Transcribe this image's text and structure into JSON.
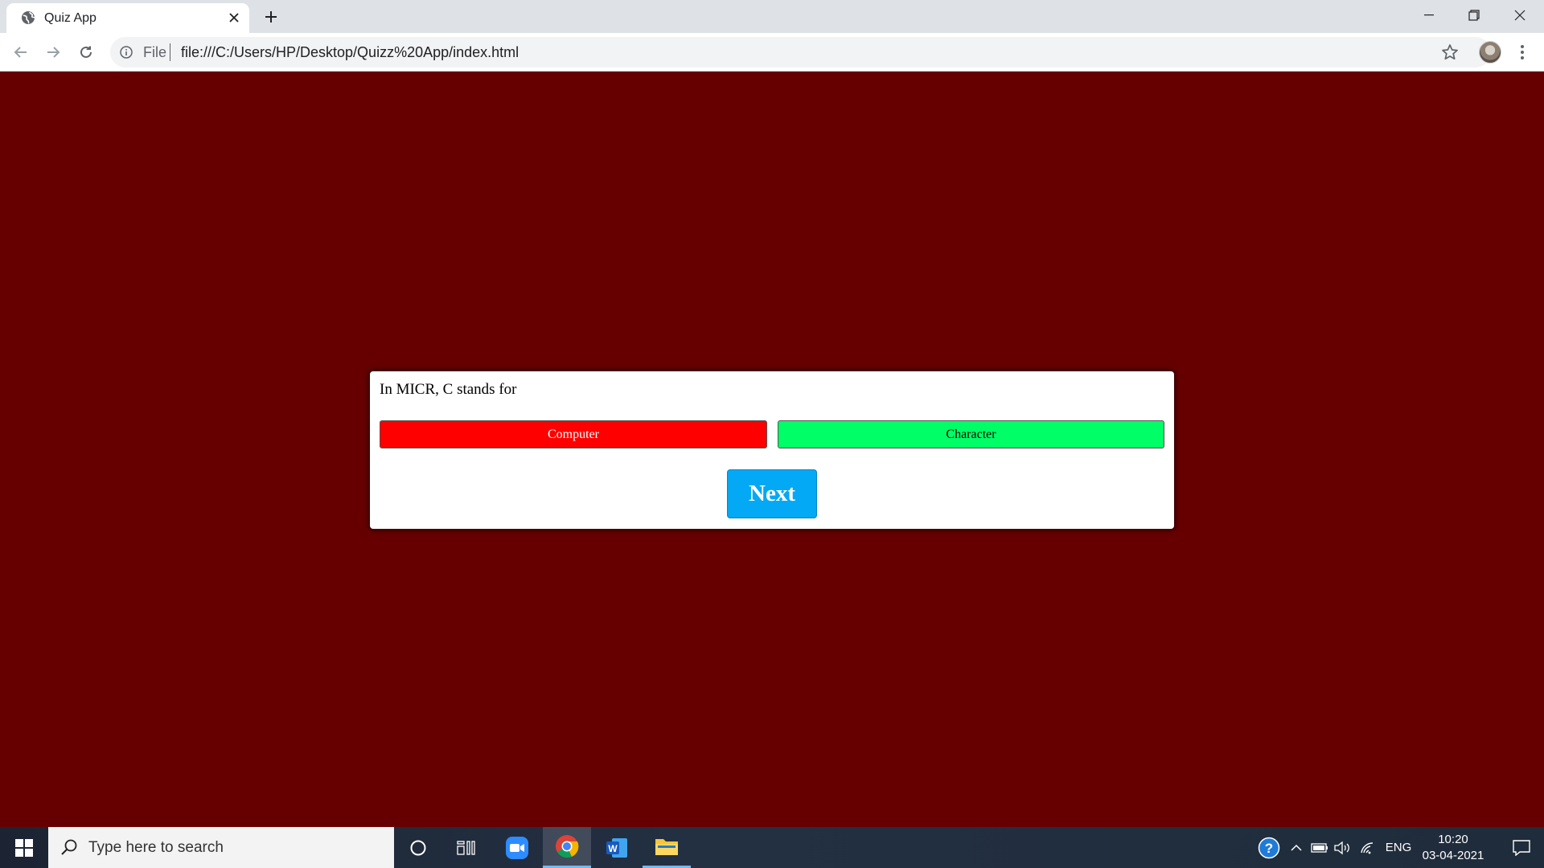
{
  "browser": {
    "tab_title": "Quiz App",
    "scheme_label": "File",
    "url": "file:///C:/Users/HP/Desktop/Quizz%20App/index.html"
  },
  "quiz": {
    "question": "In MICR, C stands for",
    "options": [
      {
        "label": "Computer",
        "color": "#ff0000"
      },
      {
        "label": "Character",
        "color": "#00ff66"
      }
    ],
    "next_label": "Next",
    "background_color": "#660000",
    "next_color": "#03a9f4"
  },
  "taskbar": {
    "search_placeholder": "Type here to search",
    "language": "ENG",
    "time": "10:20",
    "date": "03-04-2021"
  }
}
